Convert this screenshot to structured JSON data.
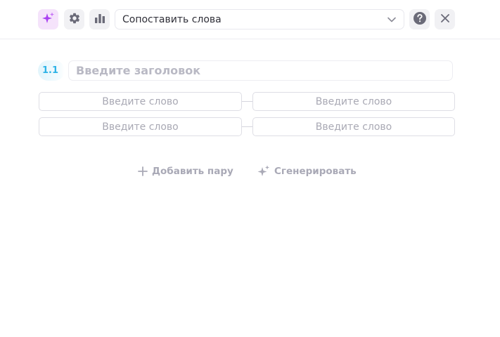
{
  "toolbar": {
    "icons": {
      "ai": "sparkle-icon",
      "settings": "gear-icon",
      "stats": "bar-chart-icon",
      "help": "help-icon",
      "close": "close-icon"
    },
    "activity_type": {
      "selected": "Сопоставить слова"
    }
  },
  "card": {
    "number": "1.1",
    "title_placeholder": "Введите заголовок",
    "pairs": [
      {
        "left_placeholder": "Введите слово",
        "right_placeholder": "Введите слово"
      },
      {
        "left_placeholder": "Введите слово",
        "right_placeholder": "Введите слово"
      }
    ],
    "add_pair_label": "Добавить пару",
    "generate_label": "Сгенерировать"
  },
  "colors": {
    "accent_ai": "#a93ff2",
    "badge_text": "#2eb3e7",
    "muted_text": "#a9a9b6"
  }
}
